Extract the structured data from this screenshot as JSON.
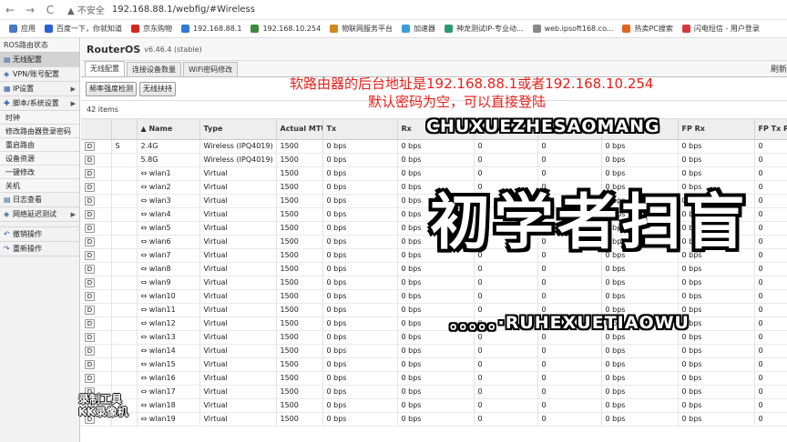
{
  "browser": {
    "back": "←",
    "forward": "→",
    "reload": "C",
    "insecure": "▲ 不安全",
    "url": "192.168.88.1/webfig/#Wireless"
  },
  "bookmarks": [
    {
      "label": "应用",
      "color": "#4a78c2"
    },
    {
      "label": "百度一下，你就知道",
      "color": "#2f5fd6"
    },
    {
      "label": "京东购物",
      "color": "#d7261e"
    },
    {
      "label": "192.168.88.1",
      "color": "#2d7bd3"
    },
    {
      "label": "192.168.10.254",
      "color": "#3c8a3c"
    },
    {
      "label": "物联网服务平台",
      "color": "#d08a1a"
    },
    {
      "label": "加速器",
      "color": "#3a9fd6"
    },
    {
      "label": "神龙测试IP-专业动...",
      "color": "#2b9c6b"
    },
    {
      "label": "web.ipsoft168.co...",
      "color": "#888888"
    },
    {
      "label": "热卖PC搜索",
      "color": "#e2641e"
    },
    {
      "label": "闪电短信 - 用户登录",
      "color": "#d23c3c"
    }
  ],
  "sidebar": {
    "header": "ROS路由状态",
    "items": [
      {
        "icon": "▤",
        "label": "无线配置",
        "active": true,
        "arrow": ""
      },
      {
        "icon": "◈",
        "label": "VPN/账号配置",
        "active": false,
        "arrow": ""
      },
      {
        "icon": "▦",
        "label": "IP设置",
        "active": false,
        "arrow": "▶"
      },
      {
        "icon": "✚",
        "label": "脚本/系统设置",
        "active": false,
        "arrow": "▶"
      }
    ],
    "subitems": [
      "时钟",
      "修改路由器登录密码",
      "重启路由",
      "设备资源",
      "一键修改",
      "关机"
    ],
    "items2": [
      {
        "icon": "▤",
        "label": "日志查看",
        "arrow": ""
      },
      {
        "icon": "◈",
        "label": "网络延迟测试",
        "arrow": "▶"
      }
    ],
    "items3": [
      {
        "icon": "↶",
        "label": "撤销操作"
      },
      {
        "icon": "↷",
        "label": "重新操作"
      }
    ]
  },
  "main": {
    "title": "RouterOS",
    "version": "v6.46.4 (stable)",
    "tabs": [
      "无线配置",
      "连接设备数量",
      "WiFi密码修改"
    ],
    "tab_right": "刷新",
    "buttons": [
      "频率强度检测",
      "无线扶持"
    ],
    "count": "42 items",
    "columns": [
      "",
      "",
      "▲ Name",
      "Type",
      "Actual MTU",
      "Tx",
      "Rx",
      "Tx Packet (p/s)",
      "Rx Packet (p/s)",
      "FP Tx",
      "FP Rx",
      "FP Tx P (p/s)"
    ],
    "rows": [
      {
        "flag": "S",
        "name": "2.4G",
        "type": "Wireless (IPQ4019)",
        "mtu": "1500",
        "tx": "0 bps",
        "rx": "0 bps",
        "txp": "0",
        "rxp": "0",
        "fptx": "0 bps",
        "fprx": "0 bps",
        "fptxp": "0"
      },
      {
        "flag": "",
        "name": "5.8G",
        "type": "Wireless (IPQ4019)",
        "mtu": "1500",
        "tx": "0 bps",
        "rx": "0 bps",
        "txp": "0",
        "rxp": "0",
        "fptx": "0 bps",
        "fprx": "0 bps",
        "fptxp": "0"
      },
      {
        "flag": "",
        "name": "⇔ wlan1",
        "type": "Virtual",
        "mtu": "1500",
        "tx": "0 bps",
        "rx": "0 bps",
        "txp": "0",
        "rxp": "0",
        "fptx": "0 bps",
        "fprx": "0 bps",
        "fptxp": "0"
      },
      {
        "flag": "",
        "name": "⇔ wlan2",
        "type": "Virtual",
        "mtu": "1500",
        "tx": "0 bps",
        "rx": "0 bps",
        "txp": "0",
        "rxp": "0",
        "fptx": "0 bps",
        "fprx": "0 bps",
        "fptxp": "0"
      },
      {
        "flag": "",
        "name": "⇔ wlan3",
        "type": "Virtual",
        "mtu": "1500",
        "tx": "0 bps",
        "rx": "0 bps",
        "txp": "0",
        "rxp": "0",
        "fptx": "0 bps",
        "fprx": "0 bps",
        "fptxp": "0"
      },
      {
        "flag": "",
        "name": "⇔ wlan4",
        "type": "Virtual",
        "mtu": "1500",
        "tx": "0 bps",
        "rx": "0 bps",
        "txp": "0",
        "rxp": "0",
        "fptx": "0 bps",
        "fprx": "0 bps",
        "fptxp": "0"
      },
      {
        "flag": "",
        "name": "⇔ wlan5",
        "type": "Virtual",
        "mtu": "1500",
        "tx": "0 bps",
        "rx": "0 bps",
        "txp": "0",
        "rxp": "0",
        "fptx": "0 bps",
        "fprx": "0 bps",
        "fptxp": "0"
      },
      {
        "flag": "",
        "name": "⇔ wlan6",
        "type": "Virtual",
        "mtu": "1500",
        "tx": "0 bps",
        "rx": "0 bps",
        "txp": "0",
        "rxp": "0",
        "fptx": "0 bps",
        "fprx": "0 bps",
        "fptxp": "0"
      },
      {
        "flag": "",
        "name": "⇔ wlan7",
        "type": "Virtual",
        "mtu": "1500",
        "tx": "0 bps",
        "rx": "0 bps",
        "txp": "0",
        "rxp": "0",
        "fptx": "0 bps",
        "fprx": "0 bps",
        "fptxp": "0"
      },
      {
        "flag": "",
        "name": "⇔ wlan8",
        "type": "Virtual",
        "mtu": "1500",
        "tx": "0 bps",
        "rx": "0 bps",
        "txp": "0",
        "rxp": "0",
        "fptx": "0 bps",
        "fprx": "0 bps",
        "fptxp": "0"
      },
      {
        "flag": "",
        "name": "⇔ wlan9",
        "type": "Virtual",
        "mtu": "1500",
        "tx": "0 bps",
        "rx": "0 bps",
        "txp": "0",
        "rxp": "0",
        "fptx": "0 bps",
        "fprx": "0 bps",
        "fptxp": "0"
      },
      {
        "flag": "",
        "name": "⇔ wlan10",
        "type": "Virtual",
        "mtu": "1500",
        "tx": "0 bps",
        "rx": "0 bps",
        "txp": "0",
        "rxp": "0",
        "fptx": "0 bps",
        "fprx": "0 bps",
        "fptxp": "0"
      },
      {
        "flag": "",
        "name": "⇔ wlan11",
        "type": "Virtual",
        "mtu": "1500",
        "tx": "0 bps",
        "rx": "0 bps",
        "txp": "0",
        "rxp": "0",
        "fptx": "0 bps",
        "fprx": "0 bps",
        "fptxp": "0"
      },
      {
        "flag": "",
        "name": "⇔ wlan12",
        "type": "Virtual",
        "mtu": "1500",
        "tx": "0 bps",
        "rx": "0 bps",
        "txp": "0",
        "rxp": "0",
        "fptx": "0 bps",
        "fprx": "0 bps",
        "fptxp": "0"
      },
      {
        "flag": "",
        "name": "⇔ wlan13",
        "type": "Virtual",
        "mtu": "1500",
        "tx": "0 bps",
        "rx": "0 bps",
        "txp": "0",
        "rxp": "0",
        "fptx": "0 bps",
        "fprx": "0 bps",
        "fptxp": "0"
      },
      {
        "flag": "",
        "name": "⇔ wlan14",
        "type": "Virtual",
        "mtu": "1500",
        "tx": "0 bps",
        "rx": "0 bps",
        "txp": "0",
        "rxp": "0",
        "fptx": "0 bps",
        "fprx": "0 bps",
        "fptxp": "0"
      },
      {
        "flag": "",
        "name": "⇔ wlan15",
        "type": "Virtual",
        "mtu": "1500",
        "tx": "0 bps",
        "rx": "0 bps",
        "txp": "0",
        "rxp": "0",
        "fptx": "0 bps",
        "fprx": "0 bps",
        "fptxp": "0"
      },
      {
        "flag": "",
        "name": "⇔ wlan16",
        "type": "Virtual",
        "mtu": "1500",
        "tx": "0 bps",
        "rx": "0 bps",
        "txp": "0",
        "rxp": "0",
        "fptx": "0 bps",
        "fprx": "0 bps",
        "fptxp": "0"
      },
      {
        "flag": "",
        "name": "⇔ wlan17",
        "type": "Virtual",
        "mtu": "1500",
        "tx": "0 bps",
        "rx": "0 bps",
        "txp": "0",
        "rxp": "0",
        "fptx": "0 bps",
        "fprx": "0 bps",
        "fptxp": "0"
      },
      {
        "flag": "",
        "name": "⇔ wlan18",
        "type": "Virtual",
        "mtu": "1500",
        "tx": "0 bps",
        "rx": "0 bps",
        "txp": "0",
        "rxp": "0",
        "fptx": "0 bps",
        "fprx": "0 bps",
        "fptxp": "0"
      },
      {
        "flag": "",
        "name": "⇔ wlan19",
        "type": "Virtual",
        "mtu": "1500",
        "tx": "0 bps",
        "rx": "0 bps",
        "txp": "0",
        "rxp": "0",
        "fptx": "0 bps",
        "fprx": "0 bps",
        "fptxp": "0"
      }
    ]
  },
  "overlay": {
    "line1": "软路由器的后台地址是192.168.88.1或者192.168.10.254",
    "line2": "默认密码为空，可以直接登陆",
    "pinyin1": "CHUXUEZHESAOMANG",
    "big": "初学者扫盲",
    "pinyin2": "。。。。。·RUHEXUETIAOWU",
    "watermark1": "录制工具",
    "watermark2": "KK录像机"
  }
}
